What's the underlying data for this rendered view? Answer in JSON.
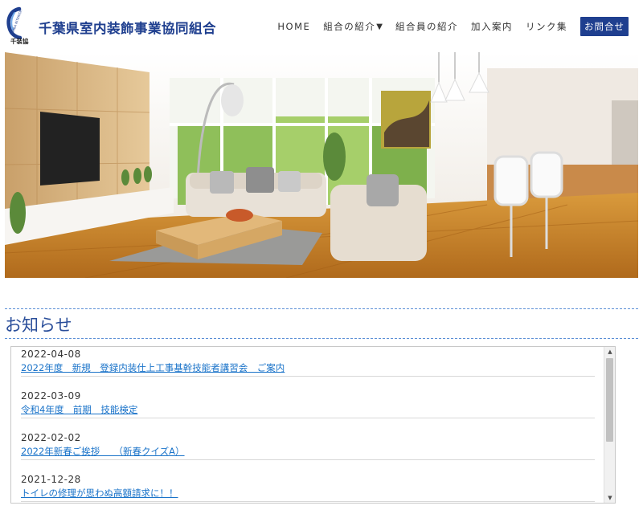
{
  "site": {
    "title": "千葉県室内装飾事業協同組合",
    "logo_sub": "千装協",
    "logo_ring_text": "CHIBA INTERIOR"
  },
  "nav": {
    "items": [
      {
        "label": "HOME"
      },
      {
        "label": "組合の紹介",
        "caret": "▼"
      },
      {
        "label": "組合員の紹介"
      },
      {
        "label": "加入案内"
      },
      {
        "label": "リンク集"
      }
    ],
    "contact_label": "お問合せ"
  },
  "notices": {
    "heading": "お知らせ",
    "items": [
      {
        "date": "2022-04-08",
        "title": "2022年度　新規　登録内装仕上工事基幹技能者講習会　ご案内"
      },
      {
        "date": "2022-03-09",
        "title": "令和4年度　前期　技能検定"
      },
      {
        "date": "2022-02-02",
        "title": "2022年新春ご挨拶　　（新春クイズA）"
      },
      {
        "date": "2021-12-28",
        "title": "トイレの修理が思わぬ高額請求に！！"
      }
    ]
  },
  "scrollbar": {
    "up": "▲",
    "down": "▼"
  },
  "colors": {
    "brand": "#1f3f8f",
    "link": "#1a73c9",
    "heading": "#2a4e9a",
    "separator": "#5b8fd6"
  }
}
